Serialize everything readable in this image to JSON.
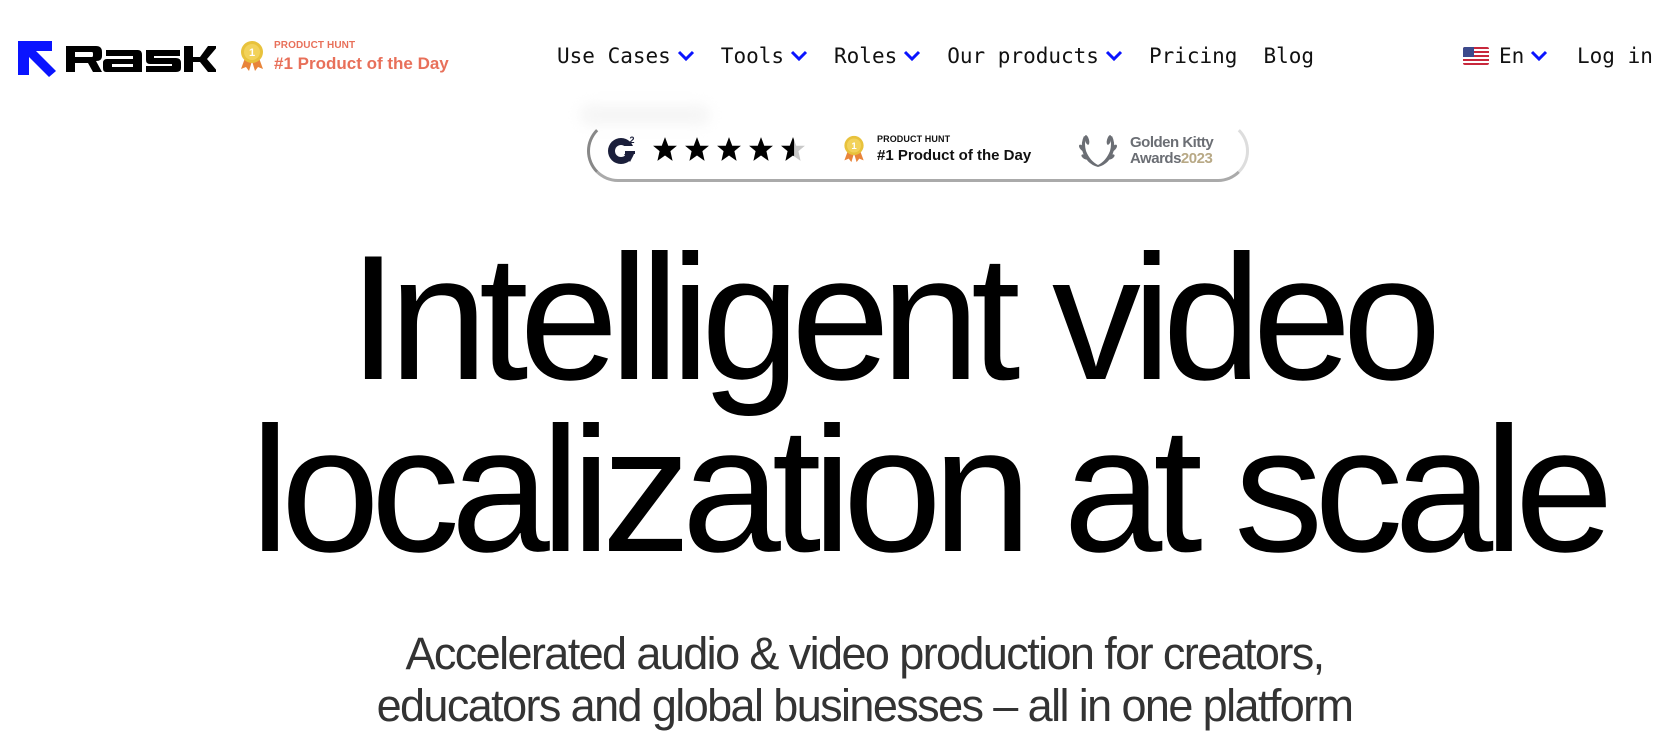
{
  "brand": {
    "name": "RASK",
    "accent_color": "#0a14ff",
    "logo_icon": "arrow-up-left-icon"
  },
  "header_badge": {
    "icon": "medal-icon",
    "medal_number": "1",
    "label_small": "PRODUCT HUNT",
    "label_big": "#1 Product of the Day",
    "color": "#e8705a"
  },
  "nav": {
    "items": [
      {
        "label": "Use Cases",
        "has_dropdown": true
      },
      {
        "label": "Tools",
        "has_dropdown": true
      },
      {
        "label": "Roles",
        "has_dropdown": true
      },
      {
        "label": "Our products",
        "has_dropdown": true
      },
      {
        "label": "Pricing",
        "has_dropdown": false
      },
      {
        "label": "Blog",
        "has_dropdown": false
      }
    ],
    "language": {
      "flag": "us-flag-icon",
      "label": "En"
    },
    "login_label": "Log in"
  },
  "badges": {
    "g2": {
      "icon": "g2-logo-icon",
      "rating_stars": 4.5,
      "max_stars": 5
    },
    "product_hunt": {
      "icon": "medal-icon",
      "medal_number": "1",
      "label_small": "PRODUCT HUNT",
      "label_big": "#1 Product of the Day"
    },
    "golden_kitty": {
      "icon": "laurel-wreath-icon",
      "line1": "Golden Kitty",
      "line2": "Awards",
      "year": "2023",
      "year_color": "#b8a986"
    }
  },
  "hero": {
    "headline_line1": "Intelligent video",
    "headline_line2": "localization at scale",
    "subtitle_line1": "Accelerated audio & video production for creators,",
    "subtitle_line2": "educators and global businesses – all in one platform"
  }
}
